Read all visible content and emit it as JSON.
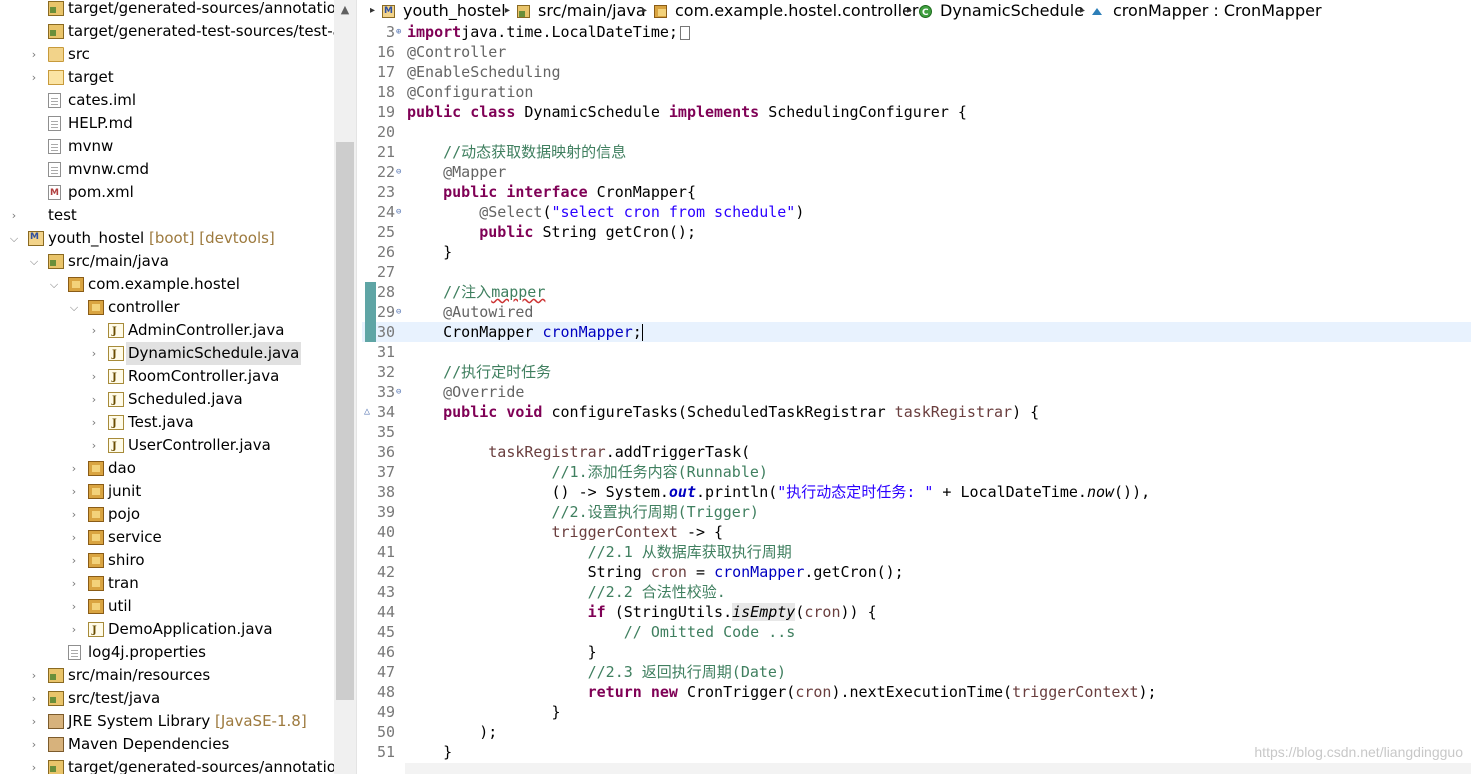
{
  "explorer": {
    "rows": [
      {
        "label": "target/generated-sources/annotations",
        "deco": "",
        "icon": "srcfolder",
        "twisty": "",
        "indent": 48,
        "selected": false
      },
      {
        "label": "target/generated-test-sources/test-annotations",
        "deco": "",
        "icon": "srcfolder",
        "twisty": "",
        "indent": 48,
        "selected": false
      },
      {
        "label": "src",
        "deco": "",
        "icon": "folder",
        "twisty": ">",
        "indent": 48,
        "selected": false
      },
      {
        "label": "target",
        "deco": "",
        "icon": "folder-open",
        "twisty": ">",
        "indent": 48,
        "selected": false
      },
      {
        "label": "cates.iml",
        "deco": "",
        "icon": "file",
        "twisty": "",
        "indent": 48,
        "selected": false
      },
      {
        "label": "HELP.md",
        "deco": "",
        "icon": "file",
        "twisty": "",
        "indent": 48,
        "selected": false
      },
      {
        "label": "mvnw",
        "deco": "",
        "icon": "file",
        "twisty": "",
        "indent": 48,
        "selected": false
      },
      {
        "label": "mvnw.cmd",
        "deco": "",
        "icon": "file",
        "twisty": "",
        "indent": 48,
        "selected": false
      },
      {
        "label": "pom.xml",
        "deco": "",
        "icon": "xml",
        "twisty": "",
        "indent": 48,
        "selected": false
      },
      {
        "label": "test",
        "deco": "",
        "icon": "none",
        "twisty": ">",
        "indent": 28,
        "selected": false
      },
      {
        "label": "youth_hostel",
        "deco": " [boot] [devtools]",
        "icon": "project",
        "twisty": "v",
        "indent": 28,
        "selected": false
      },
      {
        "label": "src/main/java",
        "deco": "",
        "icon": "srcfolder",
        "twisty": "v",
        "indent": 48,
        "selected": false
      },
      {
        "label": "com.example.hostel",
        "deco": "",
        "icon": "pkg",
        "twisty": "v",
        "indent": 68,
        "selected": false
      },
      {
        "label": "controller",
        "deco": "",
        "icon": "pkg",
        "twisty": "v",
        "indent": 88,
        "selected": false
      },
      {
        "label": "AdminController.java",
        "deco": "",
        "icon": "java",
        "twisty": ">",
        "indent": 108,
        "selected": false
      },
      {
        "label": "DynamicSchedule.java",
        "deco": "",
        "icon": "java",
        "twisty": ">",
        "indent": 108,
        "selected": true
      },
      {
        "label": "RoomController.java",
        "deco": "",
        "icon": "java",
        "twisty": ">",
        "indent": 108,
        "selected": false
      },
      {
        "label": "Scheduled.java",
        "deco": "",
        "icon": "java",
        "twisty": ">",
        "indent": 108,
        "selected": false
      },
      {
        "label": "Test.java",
        "deco": "",
        "icon": "java",
        "twisty": ">",
        "indent": 108,
        "selected": false
      },
      {
        "label": "UserController.java",
        "deco": "",
        "icon": "java",
        "twisty": ">",
        "indent": 108,
        "selected": false
      },
      {
        "label": "dao",
        "deco": "",
        "icon": "pkg",
        "twisty": ">",
        "indent": 88,
        "selected": false
      },
      {
        "label": "junit",
        "deco": "",
        "icon": "pkg",
        "twisty": ">",
        "indent": 88,
        "selected": false
      },
      {
        "label": "pojo",
        "deco": "",
        "icon": "pkg",
        "twisty": ">",
        "indent": 88,
        "selected": false
      },
      {
        "label": "service",
        "deco": "",
        "icon": "pkg",
        "twisty": ">",
        "indent": 88,
        "selected": false
      },
      {
        "label": "shiro",
        "deco": "",
        "icon": "pkg",
        "twisty": ">",
        "indent": 88,
        "selected": false
      },
      {
        "label": "tran",
        "deco": "",
        "icon": "pkg",
        "twisty": ">",
        "indent": 88,
        "selected": false
      },
      {
        "label": "util",
        "deco": "",
        "icon": "pkg",
        "twisty": ">",
        "indent": 88,
        "selected": false
      },
      {
        "label": "DemoApplication.java",
        "deco": "",
        "icon": "java",
        "twisty": ">",
        "indent": 88,
        "selected": false
      },
      {
        "label": "log4j.properties",
        "deco": "",
        "icon": "file",
        "twisty": "",
        "indent": 68,
        "selected": false
      },
      {
        "label": "src/main/resources",
        "deco": "",
        "icon": "srcfolder",
        "twisty": ">",
        "indent": 48,
        "selected": false
      },
      {
        "label": "src/test/java",
        "deco": "",
        "icon": "srcfolder",
        "twisty": ">",
        "indent": 48,
        "selected": false
      },
      {
        "label": "JRE System Library",
        "deco": " [JavaSE-1.8]",
        "icon": "lib",
        "twisty": ">",
        "indent": 48,
        "selected": false
      },
      {
        "label": "Maven Dependencies",
        "deco": "",
        "icon": "lib",
        "twisty": ">",
        "indent": 48,
        "selected": false
      },
      {
        "label": "target/generated-sources/annotations",
        "deco": "",
        "icon": "srcfolder",
        "twisty": ">",
        "indent": 48,
        "selected": false
      }
    ]
  },
  "breadcrumb": [
    {
      "label": "youth_hostel",
      "icon": "project-icon"
    },
    {
      "label": "src/main/java",
      "icon": "source-folder-icon"
    },
    {
      "label": "com.example.hostel.controller",
      "icon": "package-icon"
    },
    {
      "label": "DynamicSchedule",
      "icon": "class-icon"
    },
    {
      "label": "cronMapper : CronMapper",
      "icon": "field-icon"
    }
  ],
  "editor": {
    "current_line": 30,
    "lines": [
      {
        "n": "3",
        "fold": "⊕",
        "quickdiff": false,
        "ov": "",
        "tokens": [
          [
            "kw",
            "import"
          ],
          [
            "",
            "java.time.LocalDateTime;"
          ],
          [
            "box",
            ""
          ]
        ]
      },
      {
        "n": "16",
        "fold": "",
        "quickdiff": false,
        "ov": "",
        "tokens": [
          [
            "an",
            "@Controller"
          ]
        ]
      },
      {
        "n": "17",
        "fold": "",
        "quickdiff": false,
        "ov": "",
        "tokens": [
          [
            "an",
            "@EnableScheduling"
          ]
        ]
      },
      {
        "n": "18",
        "fold": "",
        "quickdiff": false,
        "ov": "",
        "tokens": [
          [
            "an",
            "@Configuration"
          ]
        ]
      },
      {
        "n": "19",
        "fold": "",
        "quickdiff": false,
        "ov": "",
        "tokens": [
          [
            "kw",
            "public"
          ],
          [
            "",
            " "
          ],
          [
            "kw",
            "class"
          ],
          [
            "",
            " DynamicSchedule "
          ],
          [
            "kw",
            "implements"
          ],
          [
            "",
            " SchedulingConfigurer {"
          ]
        ]
      },
      {
        "n": "20",
        "fold": "",
        "quickdiff": false,
        "ov": "",
        "tokens": []
      },
      {
        "n": "21",
        "fold": "",
        "quickdiff": false,
        "ov": "",
        "tokens": [
          [
            "",
            "    "
          ],
          [
            "cm",
            "//动态获取数据映射的信息"
          ]
        ]
      },
      {
        "n": "22",
        "fold": "⊖",
        "quickdiff": false,
        "ov": "",
        "tokens": [
          [
            "",
            "    "
          ],
          [
            "an",
            "@Mapper"
          ]
        ]
      },
      {
        "n": "23",
        "fold": "",
        "quickdiff": false,
        "ov": "",
        "tokens": [
          [
            "",
            "    "
          ],
          [
            "kw",
            "public"
          ],
          [
            "",
            " "
          ],
          [
            "kw",
            "interface"
          ],
          [
            "",
            " CronMapper{"
          ]
        ]
      },
      {
        "n": "24",
        "fold": "⊖",
        "quickdiff": false,
        "ov": "",
        "tokens": [
          [
            "",
            "        "
          ],
          [
            "an",
            "@Select"
          ],
          [
            "",
            "("
          ],
          [
            "st",
            "\"select cron from schedule\""
          ],
          [
            "",
            ")"
          ]
        ]
      },
      {
        "n": "25",
        "fold": "",
        "quickdiff": false,
        "ov": "",
        "tokens": [
          [
            "",
            "        "
          ],
          [
            "kw",
            "public"
          ],
          [
            "",
            " String getCron();"
          ]
        ]
      },
      {
        "n": "26",
        "fold": "",
        "quickdiff": false,
        "ov": "",
        "tokens": [
          [
            "",
            "    }"
          ]
        ]
      },
      {
        "n": "27",
        "fold": "",
        "quickdiff": false,
        "ov": "",
        "tokens": []
      },
      {
        "n": "28",
        "fold": "",
        "quickdiff": true,
        "ov": "",
        "tokens": [
          [
            "",
            "    "
          ],
          [
            "cm",
            "//注入"
          ],
          [
            "cm sq",
            "mapper"
          ]
        ]
      },
      {
        "n": "29",
        "fold": "⊖",
        "quickdiff": true,
        "ov": "",
        "tokens": [
          [
            "",
            "    "
          ],
          [
            "an",
            "@Autowired"
          ]
        ]
      },
      {
        "n": "30",
        "fold": "",
        "quickdiff": true,
        "ov": "",
        "tokens": [
          [
            "",
            "    CronMapper "
          ],
          [
            "fld",
            "cronMapper"
          ],
          [
            "",
            ";"
          ],
          [
            "caret",
            ""
          ]
        ]
      },
      {
        "n": "31",
        "fold": "",
        "quickdiff": false,
        "ov": "",
        "tokens": []
      },
      {
        "n": "32",
        "fold": "",
        "quickdiff": false,
        "ov": "",
        "tokens": [
          [
            "",
            "    "
          ],
          [
            "cm",
            "//执行定时任务"
          ]
        ]
      },
      {
        "n": "33",
        "fold": "⊖",
        "quickdiff": false,
        "ov": "",
        "tokens": [
          [
            "",
            "    "
          ],
          [
            "an",
            "@Override"
          ]
        ]
      },
      {
        "n": "34",
        "fold": "",
        "quickdiff": false,
        "ov": "△",
        "tokens": [
          [
            "",
            "    "
          ],
          [
            "kw",
            "public"
          ],
          [
            "",
            " "
          ],
          [
            "kw",
            "void"
          ],
          [
            "",
            " configureTasks(ScheduledTaskRegistrar "
          ],
          [
            "prm",
            "taskRegistrar"
          ],
          [
            "",
            ") {"
          ]
        ]
      },
      {
        "n": "35",
        "fold": "",
        "quickdiff": false,
        "ov": "",
        "tokens": []
      },
      {
        "n": "36",
        "fold": "",
        "quickdiff": false,
        "ov": "",
        "tokens": [
          [
            "",
            "         "
          ],
          [
            "prm",
            "taskRegistrar"
          ],
          [
            "",
            ".addTriggerTask("
          ]
        ]
      },
      {
        "n": "37",
        "fold": "",
        "quickdiff": false,
        "ov": "",
        "tokens": [
          [
            "",
            "                "
          ],
          [
            "cm",
            "//1.添加任务内容(Runnable)"
          ]
        ]
      },
      {
        "n": "38",
        "fold": "",
        "quickdiff": false,
        "ov": "",
        "tokens": [
          [
            "",
            "                () -> System."
          ],
          [
            "bi",
            "out"
          ],
          [
            "",
            ".println("
          ],
          [
            "st",
            "\"执行动态定时任务: \""
          ],
          [
            "",
            " + LocalDateTime."
          ],
          [
            "itl",
            "now"
          ],
          [
            "",
            "()),"
          ]
        ]
      },
      {
        "n": "39",
        "fold": "",
        "quickdiff": false,
        "ov": "",
        "tokens": [
          [
            "",
            "                "
          ],
          [
            "cm",
            "//2.设置执行周期(Trigger)"
          ]
        ]
      },
      {
        "n": "40",
        "fold": "",
        "quickdiff": false,
        "ov": "",
        "tokens": [
          [
            "",
            "                "
          ],
          [
            "prm",
            "triggerContext"
          ],
          [
            "",
            " -> {"
          ]
        ]
      },
      {
        "n": "41",
        "fold": "",
        "quickdiff": false,
        "ov": "",
        "tokens": [
          [
            "",
            "                    "
          ],
          [
            "cm",
            "//2.1 从数据库获取执行周期"
          ]
        ]
      },
      {
        "n": "42",
        "fold": "",
        "quickdiff": false,
        "ov": "",
        "tokens": [
          [
            "",
            "                    String "
          ],
          [
            "prm",
            "cron"
          ],
          [
            "",
            " = "
          ],
          [
            "fld",
            "cronMapper"
          ],
          [
            "",
            ".getCron();"
          ]
        ]
      },
      {
        "n": "43",
        "fold": "",
        "quickdiff": false,
        "ov": "",
        "tokens": [
          [
            "",
            "                    "
          ],
          [
            "cm",
            "//2.2 合法性校验."
          ]
        ]
      },
      {
        "n": "44",
        "fold": "",
        "quickdiff": false,
        "ov": "",
        "tokens": [
          [
            "",
            "                    "
          ],
          [
            "kw",
            "if"
          ],
          [
            "",
            " (StringUtils."
          ],
          [
            "itl hl",
            "isEmpty"
          ],
          [
            "",
            "("
          ],
          [
            "prm",
            "cron"
          ],
          [
            "",
            ")) {"
          ]
        ]
      },
      {
        "n": "45",
        "fold": "",
        "quickdiff": false,
        "ov": "",
        "tokens": [
          [
            "",
            "                        "
          ],
          [
            "cm",
            "// Omitted Code ..s"
          ]
        ]
      },
      {
        "n": "46",
        "fold": "",
        "quickdiff": false,
        "ov": "",
        "tokens": [
          [
            "",
            "                    }"
          ]
        ]
      },
      {
        "n": "47",
        "fold": "",
        "quickdiff": false,
        "ov": "",
        "tokens": [
          [
            "",
            "                    "
          ],
          [
            "cm",
            "//2.3 返回执行周期(Date)"
          ]
        ]
      },
      {
        "n": "48",
        "fold": "",
        "quickdiff": false,
        "ov": "",
        "tokens": [
          [
            "",
            "                    "
          ],
          [
            "kw",
            "return"
          ],
          [
            "",
            " "
          ],
          [
            "kw",
            "new"
          ],
          [
            "",
            " CronTrigger("
          ],
          [
            "prm",
            "cron"
          ],
          [
            "",
            ").nextExecutionTime("
          ],
          [
            "prm",
            "triggerContext"
          ],
          [
            "",
            ");"
          ]
        ]
      },
      {
        "n": "49",
        "fold": "",
        "quickdiff": false,
        "ov": "",
        "tokens": [
          [
            "",
            "                }"
          ]
        ]
      },
      {
        "n": "50",
        "fold": "",
        "quickdiff": false,
        "ov": "",
        "tokens": [
          [
            "",
            "        );"
          ]
        ]
      },
      {
        "n": "51",
        "fold": "",
        "quickdiff": false,
        "ov": "",
        "tokens": [
          [
            "",
            "    }"
          ]
        ]
      }
    ]
  },
  "watermark": "https://blog.csdn.net/liangdingguo"
}
